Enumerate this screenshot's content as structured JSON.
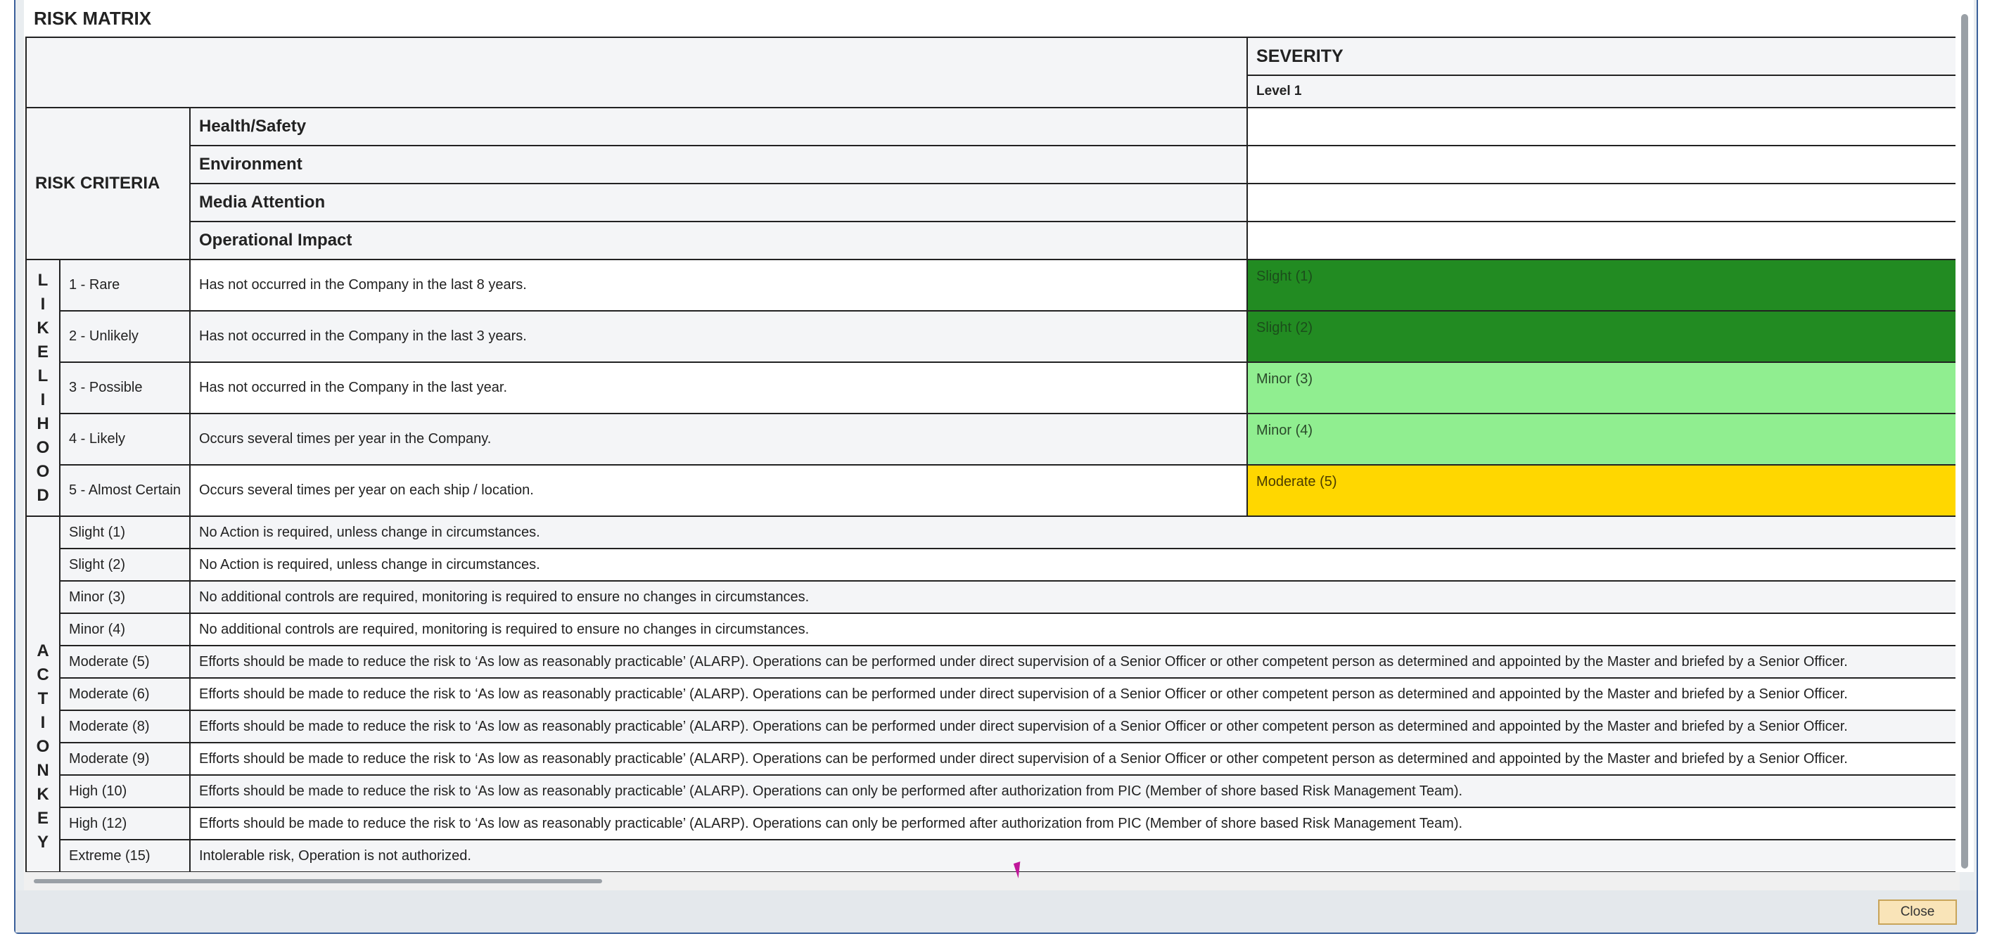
{
  "title": "RISK MATRIX",
  "severity": {
    "header": "SEVERITY",
    "level": "Level 1"
  },
  "risk_criteria": {
    "label": "RISK CRITERIA",
    "items": [
      "Health/Safety",
      "Environment",
      "Media Attention",
      "Operational Impact"
    ]
  },
  "likelihood": {
    "label": "LIKELIHOOD",
    "rows": [
      {
        "level": "1 - Rare",
        "description": "Has not occurred in the Company in the last 8 years.",
        "severity": "Slight (1)",
        "color": "#228b22"
      },
      {
        "level": "2 - Unlikely",
        "description": "Has not occurred in the Company in the last 3 years.",
        "severity": "Slight (2)",
        "color": "#228b22"
      },
      {
        "level": "3 - Possible",
        "description": "Has not occurred in the Company in the last year.",
        "severity": "Minor (3)",
        "color": "#90ee90"
      },
      {
        "level": "4 - Likely",
        "description": "Occurs several times per year in the Company.",
        "severity": "Minor (4)",
        "color": "#90ee90"
      },
      {
        "level": "5 - Almost Certain",
        "description": "Occurs several times per year on each ship / location.",
        "severity": "Moderate (5)",
        "color": "#ffd700"
      }
    ]
  },
  "action_key": {
    "label": "ACTIONKEY",
    "rows": [
      {
        "level": "Slight (1)",
        "action": "No Action is required, unless change in circumstances."
      },
      {
        "level": "Slight (2)",
        "action": "No Action is required, unless change in circumstances."
      },
      {
        "level": "Minor (3)",
        "action": "No additional controls are required, monitoring is required to ensure no changes in circumstances."
      },
      {
        "level": "Minor (4)",
        "action": "No additional controls are required, monitoring is required to ensure no changes in circumstances."
      },
      {
        "level": "Moderate (5)",
        "action": "Efforts should be made to reduce the risk to ‘As low as reasonably practicable’ (ALARP). Operations can be performed under direct supervision of a Senior Officer or other competent person as determined and appointed by the Master and briefed by a Senior Officer."
      },
      {
        "level": "Moderate (6)",
        "action": "Efforts should be made to reduce the risk to ‘As low as reasonably practicable’ (ALARP). Operations can be performed under direct supervision of a Senior Officer or other competent person as determined and appointed by the Master and briefed by a Senior Officer."
      },
      {
        "level": "Moderate (8)",
        "action": "Efforts should be made to reduce the risk to ‘As low as reasonably practicable’ (ALARP). Operations can be performed under direct supervision of a Senior Officer or other competent person as determined and appointed by the Master and briefed by a Senior Officer."
      },
      {
        "level": "Moderate (9)",
        "action": "Efforts should be made to reduce the risk to ‘As low as reasonably practicable’ (ALARP). Operations can be performed under direct supervision of a Senior Officer or other competent person as determined and appointed by the Master and briefed by a Senior Officer."
      },
      {
        "level": "High (10)",
        "action": "Efforts should be made to reduce the risk to ‘As low as reasonably practicable’ (ALARP). Operations can only be performed after authorization from PIC (Member of shore based Risk Management Team)."
      },
      {
        "level": "High (12)",
        "action": "Efforts should be made to reduce the risk to ‘As low as reasonably practicable’ (ALARP). Operations can only be performed after authorization from PIC (Member of shore based Risk Management Team)."
      },
      {
        "level": "Extreme (15)",
        "action": "Intolerable risk, Operation is not authorized."
      }
    ]
  },
  "footer": {
    "close_label": "Close"
  }
}
